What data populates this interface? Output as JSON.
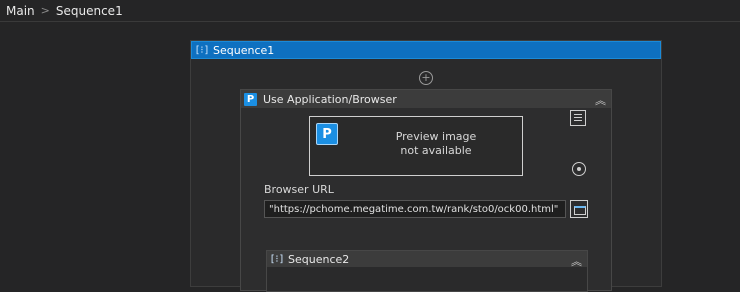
{
  "breadcrumb": {
    "items": [
      "Main",
      "Sequence1"
    ],
    "separator": ">"
  },
  "sequence1": {
    "title": "Sequence1",
    "icon": "sequence-icon",
    "header_color": "#0e70c0"
  },
  "add_activity": {
    "icon": "plus-circle-icon",
    "symbol": "+"
  },
  "use_app_browser": {
    "badge": "P",
    "title": "Use Application/Browser",
    "collapse_symbol": "≈",
    "preview_text": "Preview image\nnot available",
    "url_label": "Browser URL",
    "url_value": "\"https://pchome.megatime.com.tw/rank/sto0/ock00.html\""
  },
  "sequence2": {
    "title": "Sequence2",
    "icon": "sequence-icon",
    "collapse_symbol": "≈"
  }
}
